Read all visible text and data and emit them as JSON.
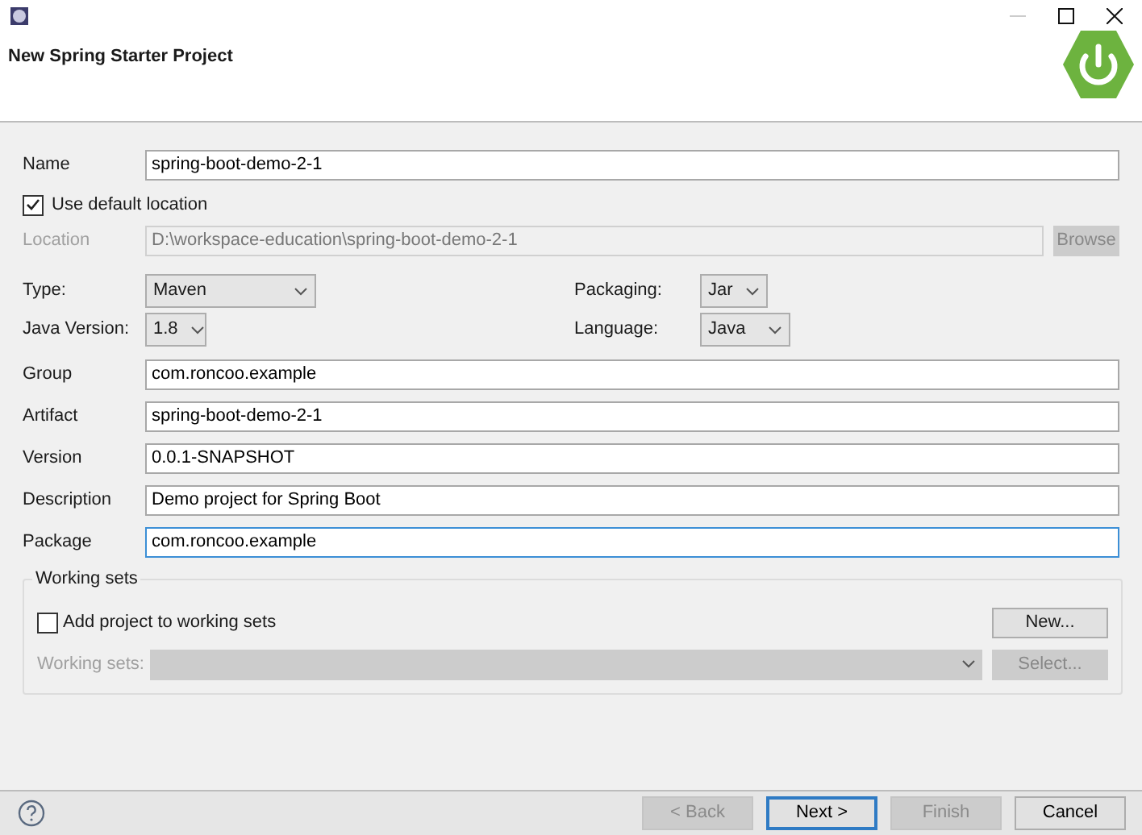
{
  "window": {
    "title": "New Spring Starter Project"
  },
  "name": {
    "label": "Name",
    "value": "spring-boot-demo-2-1"
  },
  "use_default_location": {
    "label": "Use default location",
    "checked": true
  },
  "location": {
    "label": "Location",
    "value": "D:\\workspace-education\\spring-boot-demo-2-1",
    "disabled": true,
    "button": "Browse"
  },
  "options": [
    {
      "label": "Type:",
      "value": "Maven"
    },
    {
      "label": "Packaging:",
      "value": "Jar"
    },
    {
      "label": "Java Version:",
      "value": "1.8"
    },
    {
      "label": "Language:",
      "value": "Java"
    }
  ],
  "fields": [
    {
      "label": "Group",
      "value": "com.roncoo.example",
      "focused": false
    },
    {
      "label": "Artifact",
      "value": "spring-boot-demo-2-1",
      "focused": false
    },
    {
      "label": "Version",
      "value": "0.0.1-SNAPSHOT",
      "focused": false
    },
    {
      "label": "Description",
      "value": "Demo project for Spring Boot",
      "focused": false
    },
    {
      "label": "Package",
      "value": "com.roncoo.example",
      "focused": true
    }
  ],
  "working_sets": {
    "title": "Working sets",
    "add": {
      "label": "Add project to working sets",
      "checked": false
    },
    "new_button": "New...",
    "sets_label": "Working sets:",
    "disabled": true,
    "select_button": "Select..."
  },
  "buttons": [
    {
      "label": "< Back",
      "disabled": true,
      "default": false
    },
    {
      "label": "Next >",
      "disabled": false,
      "default": true
    },
    {
      "label": "Finish",
      "disabled": true,
      "default": false
    },
    {
      "label": "Cancel",
      "disabled": false,
      "default": false
    }
  ]
}
